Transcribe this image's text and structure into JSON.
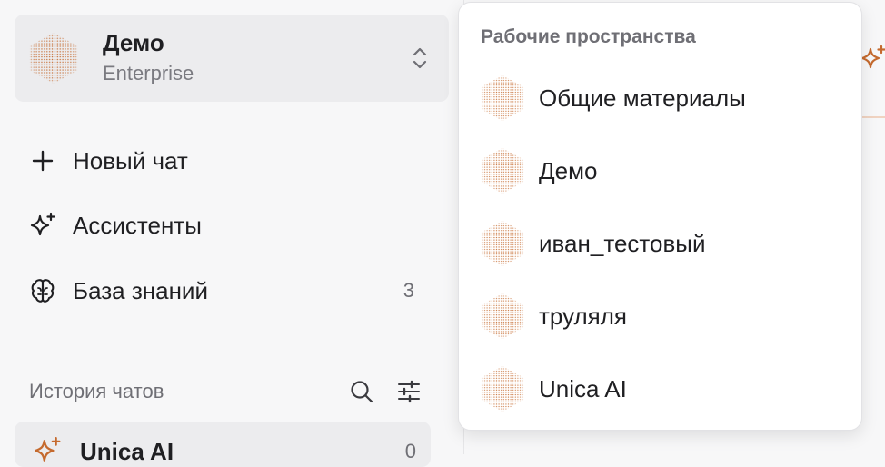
{
  "workspace": {
    "name": "Демо",
    "plan": "Enterprise",
    "logo_icon": "hexagon-dots-icon",
    "accent": "#c56a2e"
  },
  "nav": {
    "items": [
      {
        "label": "Новый чат",
        "icon": "plus-icon"
      },
      {
        "label": "Ассистенты",
        "icon": "sparkle-icon"
      },
      {
        "label": "База знаний",
        "icon": "brain-icon",
        "count": "3"
      }
    ]
  },
  "history": {
    "title": "История чатов",
    "items": [
      {
        "label": "Unica AI",
        "count": "0",
        "icon": "sparkle-icon"
      }
    ]
  },
  "dropdown": {
    "title": "Рабочие пространства",
    "items": [
      {
        "label": "Общие материалы"
      },
      {
        "label": "Демо"
      },
      {
        "label": "иван_тестовый"
      },
      {
        "label": "труляля"
      },
      {
        "label": "Unica AI"
      }
    ]
  }
}
